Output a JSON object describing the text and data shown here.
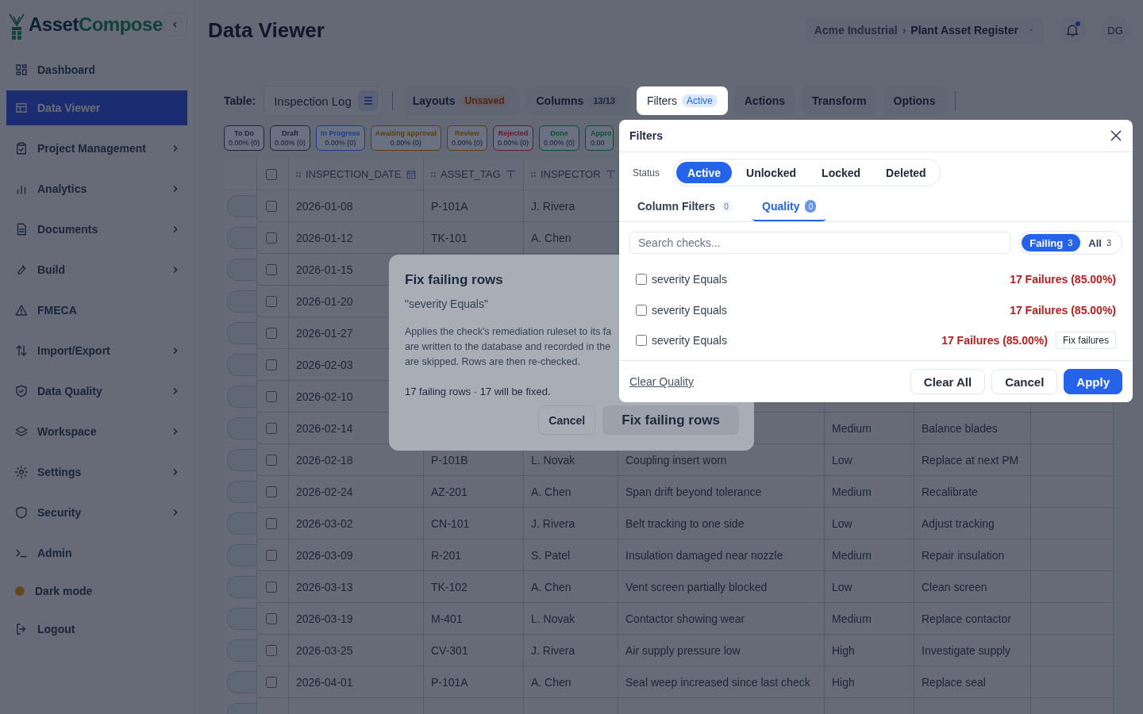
{
  "brand": {
    "name_part_1": "Asset",
    "name_part_2": "Compose"
  },
  "sidebar": {
    "items": [
      {
        "label": "Dashboard",
        "selected": false,
        "has_submenu": false
      },
      {
        "label": "Data Viewer",
        "selected": true,
        "has_submenu": false
      },
      {
        "label": "Project Management",
        "selected": false,
        "has_submenu": true
      },
      {
        "label": "Analytics",
        "selected": false,
        "has_submenu": true
      },
      {
        "label": "Documents",
        "selected": false,
        "has_submenu": true
      },
      {
        "label": "Build",
        "selected": false,
        "has_submenu": true
      },
      {
        "label": "FMECA",
        "selected": false,
        "has_submenu": false
      },
      {
        "label": "Import/Export",
        "selected": false,
        "has_submenu": true
      },
      {
        "label": "Data Quality",
        "selected": false,
        "has_submenu": true
      },
      {
        "label": "Workspace",
        "selected": false,
        "has_submenu": true
      },
      {
        "label": "Settings",
        "selected": false,
        "has_submenu": true
      },
      {
        "label": "Security",
        "selected": false,
        "has_submenu": true
      },
      {
        "label": "Admin",
        "selected": false,
        "has_submenu": false
      }
    ],
    "dark_mode": "Dark mode",
    "logout": "Logout"
  },
  "page_title": "Data Viewer",
  "breadcrumb": {
    "workspace": "Acme Industrial",
    "separator": "›",
    "project": "Plant Asset Register"
  },
  "notifications": {
    "unread": true
  },
  "user": {
    "initials": "DG"
  },
  "toolbar": {
    "table_label": "Table:",
    "table_name": "Inspection Log",
    "tabs": [
      {
        "label": "Layouts",
        "badge": "Unsaved",
        "kind": "warning",
        "selected": false
      },
      {
        "label": "Columns",
        "badge": "13/13",
        "kind": "neutral",
        "selected": false
      },
      {
        "label": "Filters",
        "badge": "Active",
        "kind": "info",
        "selected": true
      },
      {
        "label": "Actions",
        "kind": "plain",
        "selected": false
      },
      {
        "label": "Transform",
        "kind": "plain",
        "selected": false
      },
      {
        "label": "Options",
        "kind": "plain",
        "selected": false
      }
    ]
  },
  "status_chips": [
    {
      "label": "To Do",
      "count": "0.00% (0)",
      "color": "#1f2633"
    },
    {
      "label": "Draft",
      "count": "0.00% (0)",
      "color": "#1f2633"
    },
    {
      "label": "In Progress",
      "count": "0.00% (0)",
      "color": "#1c3d8f"
    },
    {
      "label": "Awaiting approval",
      "count": "0.00% (0)",
      "color": "#5e3f0a"
    },
    {
      "label": "Review",
      "count": "0.00% (0)",
      "color": "#5e3f0a"
    },
    {
      "label": "Rejected",
      "count": "0.00% (0)",
      "color": "#6e1430"
    },
    {
      "label": "Done",
      "count": "0.00% (0)",
      "color": "#0f4d33"
    },
    {
      "label": "Appro",
      "count": "0.00",
      "color": "#0f4d33"
    }
  ],
  "table": {
    "all_checked": false,
    "columns": [
      {
        "label": "INSPECTION_DATE",
        "kind": "date"
      },
      {
        "label": "ASSET_TAG",
        "kind": "text"
      },
      {
        "label": "INSPECTOR",
        "kind": "text"
      }
    ],
    "rows": [
      {
        "checked": false,
        "inspection_date": "2026-01-08",
        "asset_tag": "P-101A",
        "inspector": "J. Rivera"
      },
      {
        "checked": false,
        "inspection_date": "2026-01-12",
        "asset_tag": "TK-101",
        "inspector": "A. Chen"
      },
      {
        "checked": false,
        "inspection_date": "2026-01-15"
      },
      {
        "checked": false,
        "inspection_date": "2026-01-20"
      },
      {
        "checked": false,
        "inspection_date": "2026-01-27"
      },
      {
        "checked": false,
        "inspection_date": "2026-02-03"
      },
      {
        "checked": false,
        "inspection_date": "2026-02-10"
      },
      {
        "checked": false,
        "inspection_date": "2026-02-14",
        "severity": "Medium",
        "action": "Balance blades"
      },
      {
        "checked": false,
        "inspection_date": "2026-02-18",
        "asset_tag": "P-101B",
        "inspector": "L. Novak",
        "description": "Coupling insert worn",
        "severity": "Low",
        "action": "Replace at next PM"
      },
      {
        "checked": false,
        "inspection_date": "2026-02-24",
        "asset_tag": "AZ-201",
        "inspector": "A. Chen",
        "description": "Span drift beyond tolerance",
        "severity": "Medium",
        "action": "Recalibrate"
      },
      {
        "checked": false,
        "inspection_date": "2026-03-02",
        "asset_tag": "CN-101",
        "inspector": "J. Rivera",
        "description": "Belt tracking to one side",
        "severity": "Low",
        "action": "Adjust tracking"
      },
      {
        "checked": false,
        "inspection_date": "2026-03-09",
        "asset_tag": "R-201",
        "inspector": "S. Patel",
        "description": "Insulation damaged near nozzle",
        "severity": "Medium",
        "action": "Repair insulation"
      },
      {
        "checked": false,
        "inspection_date": "2026-03-13",
        "asset_tag": "TK-102",
        "inspector": "A. Chen",
        "description": "Vent screen partially blocked",
        "severity": "Low",
        "action": "Clean screen"
      },
      {
        "checked": false,
        "inspection_date": "2026-03-19",
        "asset_tag": "M-401",
        "inspector": "L. Novak",
        "description": "Contactor showing wear",
        "severity": "Medium",
        "action": "Replace contactor"
      },
      {
        "checked": false,
        "inspection_date": "2026-03-25",
        "asset_tag": "CV-301",
        "inspector": "J. Rivera",
        "description": "Air supply pressure low",
        "severity": "High",
        "action": "Investigate supply"
      },
      {
        "checked": false,
        "inspection_date": "2026-04-01",
        "asset_tag": "P-101A",
        "inspector": "A. Chen",
        "description": "Seal weep increased since last check",
        "severity": "High",
        "action": "Replace seal"
      }
    ]
  },
  "dialog": {
    "title": "Fix failing rows",
    "subtitle": "\"severity Equals\"",
    "body_lines": [
      "Applies the check's remediation ruleset to its fa",
      "are written to the database and recorded in the",
      "are skipped. Rows are then re-checked."
    ],
    "summary": "17 failing rows · 17 will be fixed.",
    "buttons": [
      {
        "label": "Cancel",
        "kind": "secondary"
      },
      {
        "label": "Fix failing rows",
        "kind": "primary"
      }
    ]
  },
  "filters_panel": {
    "title": "Filters",
    "status_label": "Status",
    "status_options": [
      {
        "label": "Active",
        "selected": true
      },
      {
        "label": "Unlocked",
        "selected": false
      },
      {
        "label": "Locked",
        "selected": false
      },
      {
        "label": "Deleted",
        "selected": false
      }
    ],
    "subtabs": [
      {
        "label": "Column Filters",
        "count": "0",
        "selected": false
      },
      {
        "label": "Quality",
        "count": "0",
        "selected": true
      }
    ],
    "search": {
      "placeholder": "Search checks..."
    },
    "scope": [
      {
        "label": "Failing",
        "count": "3",
        "selected": true
      },
      {
        "label": "All",
        "count": "3",
        "selected": false
      }
    ],
    "checks": [
      {
        "name": "severity Equals",
        "checked": false,
        "result": "17 Failures (85.00%)"
      },
      {
        "name": "severity Equals",
        "checked": false,
        "result": "17 Failures (85.00%)"
      },
      {
        "name": "severity Equals",
        "checked": false,
        "result": "17 Failures (85.00%)",
        "fix_button": "Fix failures"
      }
    ],
    "clear_link": "Clear Quality",
    "buttons": [
      {
        "label": "Clear All",
        "kind": "secondary"
      },
      {
        "label": "Cancel",
        "kind": "secondary"
      },
      {
        "label": "Apply",
        "kind": "primary"
      }
    ]
  }
}
